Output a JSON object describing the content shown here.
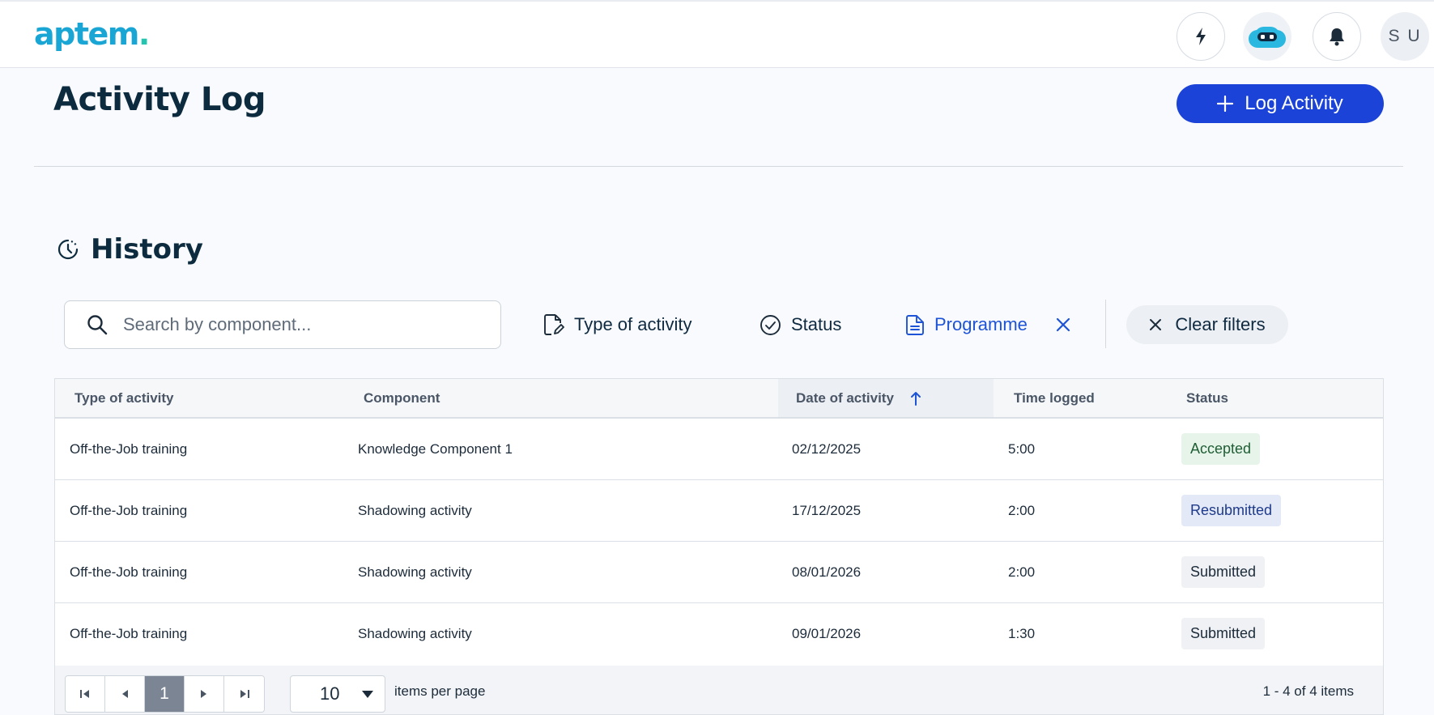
{
  "brand": {
    "logo_text": "aptem",
    "logo_dot": "."
  },
  "topbar": {
    "quick_actions_icon": "lightning-icon",
    "assistant_icon": "robot-assistant-icon",
    "notifications_icon": "bell-icon",
    "avatar_initials": "S U"
  },
  "page": {
    "title": "Activity Log",
    "log_button_label": "Log Activity"
  },
  "history": {
    "title": "History",
    "search_placeholder": "Search by component...",
    "filters": {
      "type": "Type of activity",
      "status": "Status",
      "programme": "Programme",
      "clear": "Clear filters"
    }
  },
  "table": {
    "columns": [
      "Type of activity",
      "Component",
      "Date of activity",
      "Time logged",
      "Status"
    ],
    "sorted_column": "Date of activity",
    "sort_direction": "ascending",
    "rows": [
      {
        "type": "Off-the-Job training",
        "component": "Knowledge Component 1",
        "date": "02/12/2025",
        "time": "5:00",
        "status": "Accepted"
      },
      {
        "type": "Off-the-Job training",
        "component": "Shadowing activity",
        "date": "17/12/2025",
        "time": "2:00",
        "status": "Resubmitted"
      },
      {
        "type": "Off-the-Job training",
        "component": "Shadowing activity",
        "date": "08/01/2026",
        "time": "2:00",
        "status": "Submitted"
      },
      {
        "type": "Off-the-Job training",
        "component": "Shadowing activity",
        "date": "09/01/2026",
        "time": "1:30",
        "status": "Submitted"
      }
    ]
  },
  "pager": {
    "current_page": "1",
    "page_size": "10",
    "page_size_label": "items per page",
    "info": "1 - 4 of 4 items"
  },
  "colors": {
    "primary": "#1c43d8",
    "accent_link": "#1d53d6",
    "accepted_bg": "#e6f4ea",
    "resubmitted_bg": "#e3e9f7",
    "submitted_bg": "#eff1f4"
  }
}
